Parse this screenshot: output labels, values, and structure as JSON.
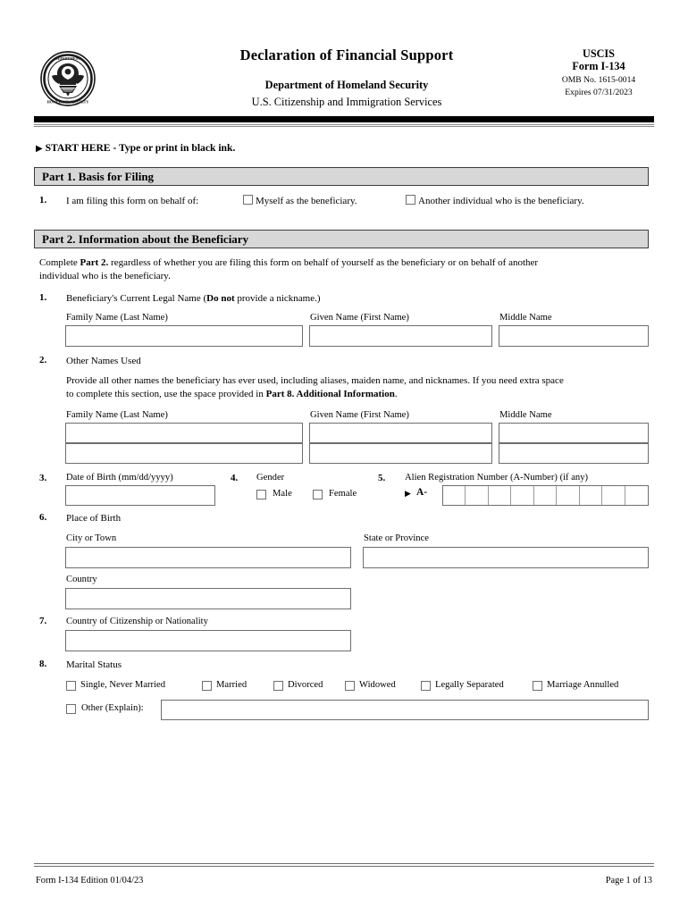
{
  "header": {
    "seal_icon": "dhs-seal-icon",
    "title": "Declaration of Financial Support",
    "department": "Department of Homeland Security",
    "agency": "U.S. Citizenship and Immigration Services",
    "uscis": "USCIS",
    "form_number": "Form I-134",
    "omb": "OMB No. 1615-0014",
    "expires": "Expires 07/31/2023"
  },
  "start_here": {
    "arrow": "▶",
    "text": "START HERE - Type or print in black ink."
  },
  "part1": {
    "heading": "Part 1.  Basis for Filing",
    "q1_number": "1.",
    "q1_text": "I am filing this form on behalf of:",
    "option_self": "Myself as the beneficiary.",
    "option_other": "Another individual who is the beneficiary."
  },
  "part2": {
    "heading": "Part 2.  Information about the Beneficiary",
    "intro_1": "Complete ",
    "intro_bold": "Part 2.",
    "intro_2": " regardless of whether you are filing this form on behalf of yourself as the beneficiary or on behalf of another",
    "intro_3": "individual who is the beneficiary.",
    "q1": {
      "number": "1.",
      "text_pre": "Beneficiary's Current Legal Name (",
      "text_bold": "Do not",
      "text_post": " provide a nickname.)",
      "label_family": "Family Name (Last Name)",
      "label_given": "Given Name (First Name)",
      "label_middle": "Middle Name",
      "value_family": "",
      "value_given": "",
      "value_middle": ""
    },
    "q2": {
      "number": "2.",
      "title": "Other Names Used",
      "help_1": "Provide all other names the beneficiary has ever used, including aliases, maiden name, and nicknames.  If you need extra space",
      "help_2_pre": "to complete this section, use the space provided in ",
      "help_2_bold": "Part 8. Additional Information",
      "help_2_post": ".",
      "label_family": "Family Name (Last Name)",
      "label_given": "Given Name (First Name)",
      "label_middle": "Middle Name",
      "rows": [
        {
          "family": "",
          "given": "",
          "middle": ""
        },
        {
          "family": "",
          "given": "",
          "middle": ""
        }
      ]
    },
    "q3": {
      "number": "3.",
      "label": "Date of Birth (mm/dd/yyyy)",
      "value": ""
    },
    "q4": {
      "number": "4.",
      "label": "Gender",
      "option_male": "Male",
      "option_female": "Female"
    },
    "q5": {
      "number": "5.",
      "label": "Alien Registration Number (A-Number) (if any)",
      "arrow": "▶",
      "prefix": "A-",
      "cells": 9,
      "value": ""
    },
    "q6": {
      "number": "6.",
      "title": "Place of Birth",
      "label_city": "City or Town",
      "label_state": "State or Province",
      "label_country": "Country",
      "value_city": "",
      "value_state": "",
      "value_country": ""
    },
    "q7": {
      "number": "7.",
      "label": "Country of Citizenship or Nationality",
      "value": ""
    },
    "q8": {
      "number": "8.",
      "title": "Marital Status",
      "options": [
        "Single, Never Married",
        "Married",
        "Divorced",
        "Widowed",
        "Legally Separated",
        "Marriage Annulled"
      ],
      "other_label": "Other (Explain):",
      "other_value": ""
    }
  },
  "footer": {
    "left": "Form I-134   Edition  01/04/23",
    "right": "Page 1 of 13"
  },
  "colors": {
    "part_bar_bg": "#d7d7d7",
    "rule": "#000000",
    "field_border": "#6e6e6e"
  }
}
